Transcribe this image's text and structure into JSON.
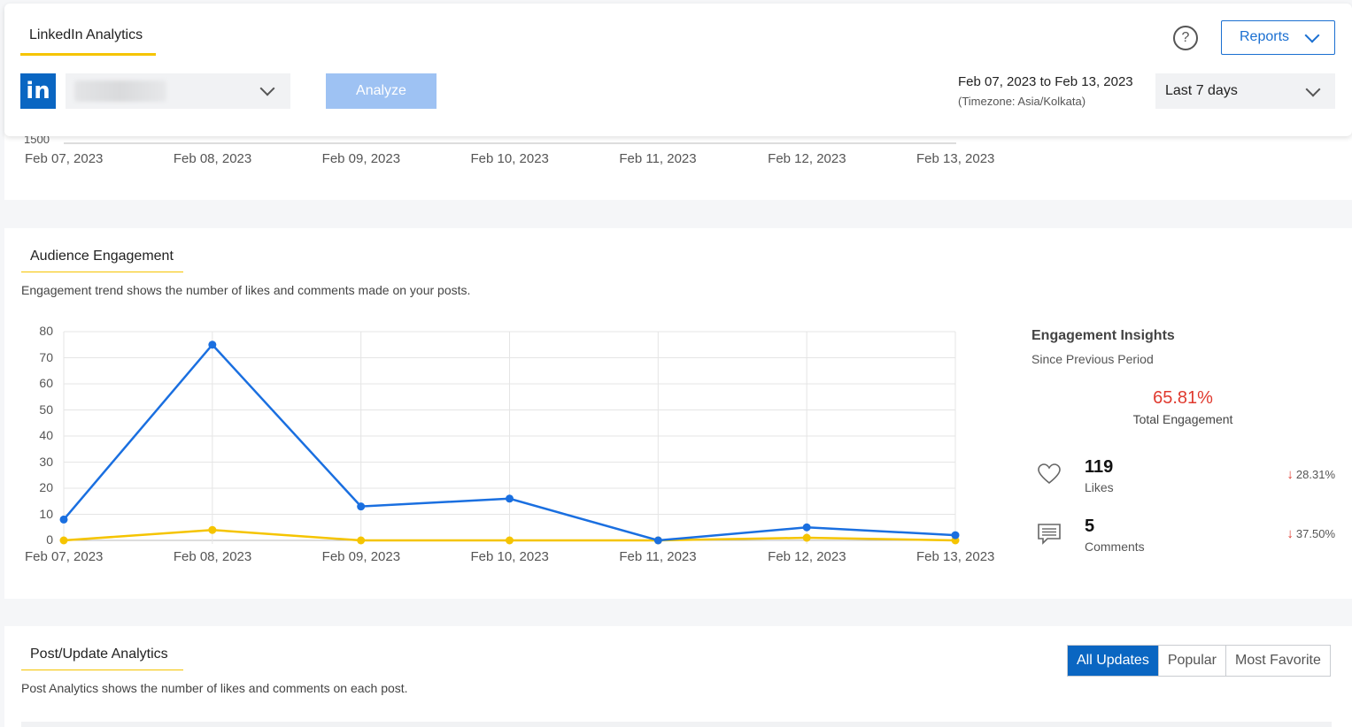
{
  "header": {
    "tab_title": "LinkedIn Analytics",
    "logo_text": "in",
    "account_select_value": "",
    "analyze_label": "Analyze",
    "date_range": "Feb 07, 2023 to Feb 13, 2023",
    "timezone": "(Timezone: Asia/Kolkata)",
    "period_value": "Last 7 days",
    "help_symbol": "?",
    "reports_label": "Reports"
  },
  "top_chart_strip": {
    "partial_tick": "1500",
    "x_labels": [
      "Feb 07, 2023",
      "Feb 08, 2023",
      "Feb 09, 2023",
      "Feb 10, 2023",
      "Feb 11, 2023",
      "Feb 12, 2023",
      "Feb 13, 2023"
    ]
  },
  "engagement": {
    "title": "Audience Engagement",
    "subtitle": "Engagement trend shows the number of likes and comments made on your posts."
  },
  "chart_data": {
    "type": "line",
    "x": [
      "Feb 07, 2023",
      "Feb 08, 2023",
      "Feb 09, 2023",
      "Feb 10, 2023",
      "Feb 11, 2023",
      "Feb 12, 2023",
      "Feb 13, 2023"
    ],
    "ylim": [
      0,
      80
    ],
    "yticks": [
      0,
      10,
      20,
      30,
      40,
      50,
      60,
      70,
      80
    ],
    "grid": true,
    "series": [
      {
        "values": [
          8,
          75,
          13,
          16,
          0,
          5,
          2
        ],
        "color": "#1a6fe0"
      },
      {
        "values": [
          0,
          4,
          0,
          0,
          0,
          1,
          0
        ],
        "color": "#f5c400"
      }
    ]
  },
  "insights": {
    "title": "Engagement Insights",
    "subtitle": "Since Previous Period",
    "total_pct": "65.81%",
    "total_label": "Total Engagement",
    "likes_value": "119",
    "likes_label": "Likes",
    "likes_change": "28.31%",
    "comments_value": "5",
    "comments_label": "Comments",
    "comments_change": "37.50%",
    "change_arrow": "↓",
    "change_color": "#e03a2f"
  },
  "posts": {
    "title": "Post/Update Analytics",
    "subtitle": "Post Analytics shows the number of likes and comments on each post.",
    "filters": [
      "All Updates",
      "Popular",
      "Most Favorite"
    ],
    "active_filter": "All Updates"
  },
  "colors": {
    "accent": "#f5c400",
    "brand": "#0a66c2",
    "line_blue": "#1a6fe0",
    "line_yellow": "#f5c400",
    "negative": "#e03a2f"
  }
}
